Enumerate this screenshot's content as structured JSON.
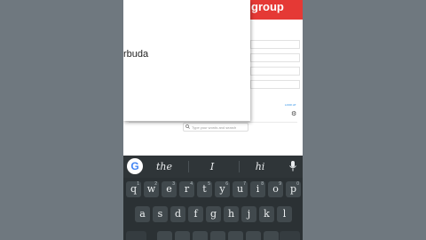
{
  "app": {
    "header_text": "group",
    "header_color": "#e53935",
    "link_text": "LOOK AT",
    "search_placeholder": "Type your words and search",
    "settings_icon": "gear-icon"
  },
  "dropdown": {
    "visible_item": "rbuda"
  },
  "keyboard": {
    "suggestions": [
      "the",
      "I",
      "hi"
    ],
    "logo_letter": "G",
    "row1": [
      {
        "key": "q",
        "hint": "1"
      },
      {
        "key": "w",
        "hint": "2"
      },
      {
        "key": "e",
        "hint": "3"
      },
      {
        "key": "r",
        "hint": "4"
      },
      {
        "key": "t",
        "hint": "5"
      },
      {
        "key": "y",
        "hint": "6"
      },
      {
        "key": "u",
        "hint": "7"
      },
      {
        "key": "i",
        "hint": "8"
      },
      {
        "key": "o",
        "hint": "9"
      },
      {
        "key": "p",
        "hint": "0"
      }
    ],
    "row2": [
      "a",
      "s",
      "d",
      "f",
      "g",
      "h",
      "j",
      "k",
      "l"
    ]
  }
}
